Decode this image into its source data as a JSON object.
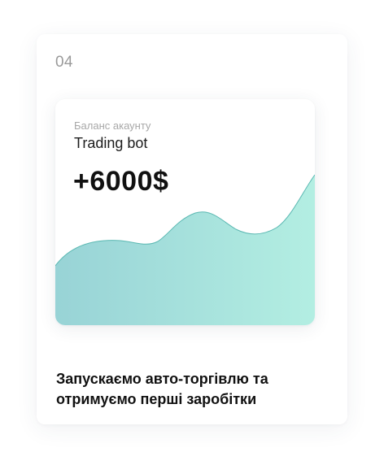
{
  "step": {
    "number": "04"
  },
  "balance_card": {
    "label": "Баланс акаунту",
    "account_name": "Trading bot",
    "value": "+6000$",
    "chart": {
      "fill_start_color": "#98d3d6",
      "fill_end_color": "#b3eee2",
      "line_color": "#5ab8b2"
    }
  },
  "caption": {
    "line1": "Запускаємо авто-торгівлю та",
    "line2": "отримуємо перші заробітки"
  }
}
